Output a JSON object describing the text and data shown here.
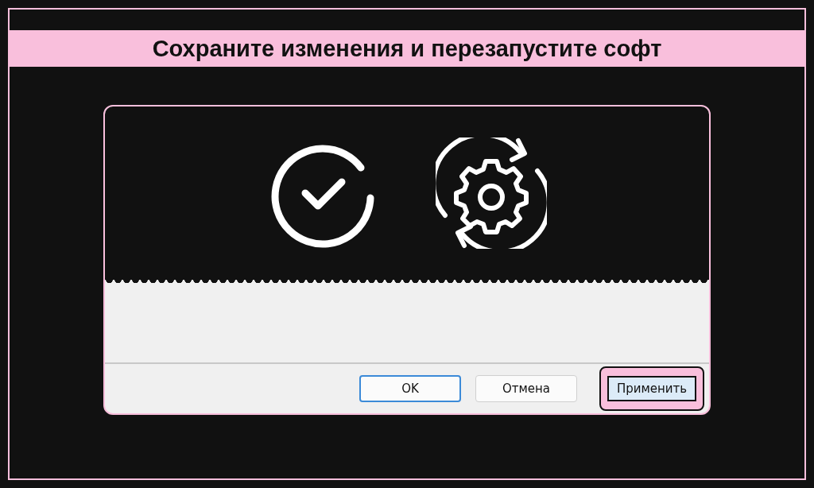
{
  "title": "Сохраните изменения и перезапустите софт",
  "buttons": [
    {
      "label": "OK",
      "default": true,
      "highlighted": false
    },
    {
      "label": "Отмена",
      "default": false,
      "highlighted": false
    },
    {
      "label": "Применить",
      "default": false,
      "highlighted": true
    }
  ]
}
